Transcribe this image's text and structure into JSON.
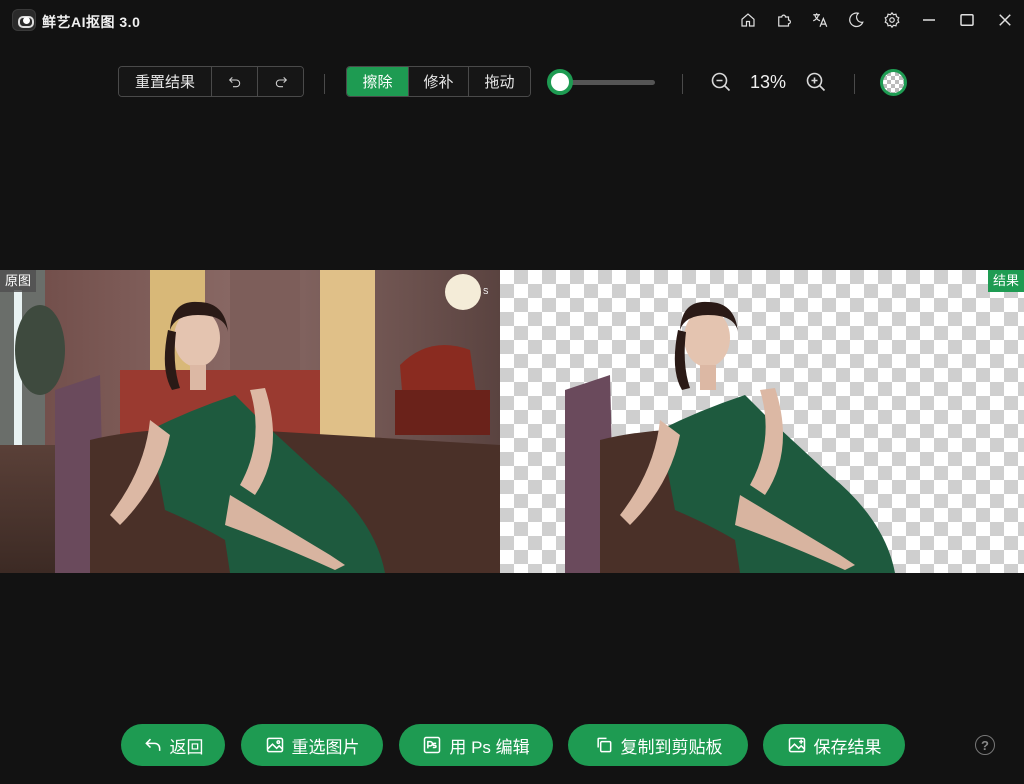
{
  "app": {
    "title": "鲜艺AI抠图  3.0"
  },
  "toolbar": {
    "reset_label": "重置结果",
    "modes": [
      {
        "label": "擦除",
        "active": true
      },
      {
        "label": "修补",
        "active": false
      },
      {
        "label": "拖动",
        "active": false
      }
    ],
    "brush_size_fraction": 0.0,
    "zoom": "13%"
  },
  "canvas": {
    "original_label": "原图",
    "result_label": "结果"
  },
  "actions": {
    "back": "返回",
    "reselect": "重选图片",
    "ps_edit": "用 Ps 编辑",
    "copy": "复制到剪贴板",
    "save": "保存结果"
  },
  "help": "?",
  "colors": {
    "accent": "#1e9b52",
    "background": "#121212"
  }
}
